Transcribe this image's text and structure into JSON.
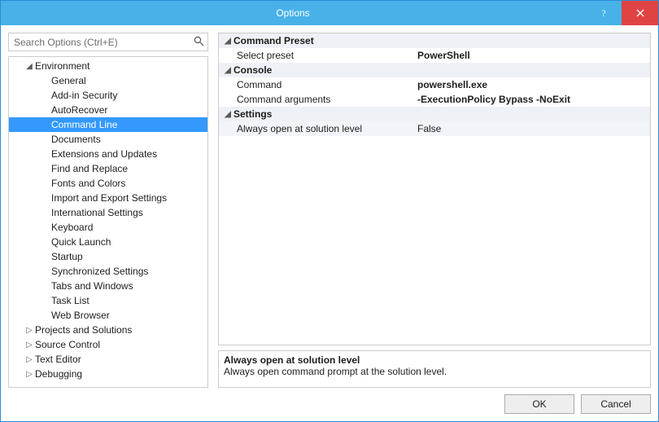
{
  "window": {
    "title": "Options"
  },
  "search": {
    "placeholder": "Search Options (Ctrl+E)"
  },
  "tree": [
    {
      "label": "Environment",
      "depth": 1,
      "expander": "open",
      "selected": false
    },
    {
      "label": "General",
      "depth": 2,
      "expander": "none",
      "selected": false
    },
    {
      "label": "Add-in Security",
      "depth": 2,
      "expander": "none",
      "selected": false
    },
    {
      "label": "AutoRecover",
      "depth": 2,
      "expander": "none",
      "selected": false
    },
    {
      "label": "Command Line",
      "depth": 2,
      "expander": "none",
      "selected": true
    },
    {
      "label": "Documents",
      "depth": 2,
      "expander": "none",
      "selected": false
    },
    {
      "label": "Extensions and Updates",
      "depth": 2,
      "expander": "none",
      "selected": false
    },
    {
      "label": "Find and Replace",
      "depth": 2,
      "expander": "none",
      "selected": false
    },
    {
      "label": "Fonts and Colors",
      "depth": 2,
      "expander": "none",
      "selected": false
    },
    {
      "label": "Import and Export Settings",
      "depth": 2,
      "expander": "none",
      "selected": false
    },
    {
      "label": "International Settings",
      "depth": 2,
      "expander": "none",
      "selected": false
    },
    {
      "label": "Keyboard",
      "depth": 2,
      "expander": "none",
      "selected": false
    },
    {
      "label": "Quick Launch",
      "depth": 2,
      "expander": "none",
      "selected": false
    },
    {
      "label": "Startup",
      "depth": 2,
      "expander": "none",
      "selected": false
    },
    {
      "label": "Synchronized Settings",
      "depth": 2,
      "expander": "none",
      "selected": false
    },
    {
      "label": "Tabs and Windows",
      "depth": 2,
      "expander": "none",
      "selected": false
    },
    {
      "label": "Task List",
      "depth": 2,
      "expander": "none",
      "selected": false
    },
    {
      "label": "Web Browser",
      "depth": 2,
      "expander": "none",
      "selected": false
    },
    {
      "label": "Projects and Solutions",
      "depth": 1,
      "expander": "closed",
      "selected": false
    },
    {
      "label": "Source Control",
      "depth": 1,
      "expander": "closed",
      "selected": false
    },
    {
      "label": "Text Editor",
      "depth": 1,
      "expander": "closed",
      "selected": false
    },
    {
      "label": "Debugging",
      "depth": 1,
      "expander": "closed",
      "selected": false
    }
  ],
  "propgrid": [
    {
      "kind": "cat",
      "label": "Command Preset"
    },
    {
      "kind": "prop",
      "label": "Select preset",
      "value": "PowerShell",
      "bold": true
    },
    {
      "kind": "cat",
      "label": "Console"
    },
    {
      "kind": "prop",
      "label": "Command",
      "value": "powershell.exe",
      "bold": true
    },
    {
      "kind": "prop",
      "label": "Command arguments",
      "value": "-ExecutionPolicy Bypass -NoExit",
      "bold": true
    },
    {
      "kind": "cat",
      "label": "Settings"
    },
    {
      "kind": "prop",
      "label": "Always open at solution level",
      "value": "False",
      "hl": true
    }
  ],
  "description": {
    "title": "Always open at solution level",
    "body": "Always open command prompt at the solution level."
  },
  "buttons": {
    "ok": "OK",
    "cancel": "Cancel"
  }
}
